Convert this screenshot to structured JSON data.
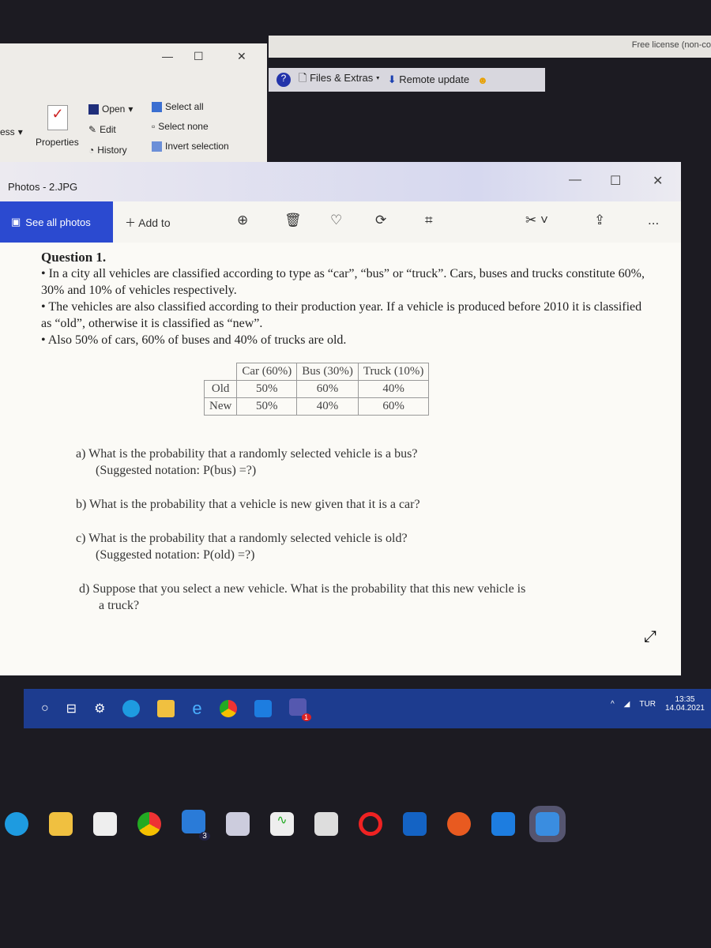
{
  "top": {
    "license_text": "Free license (non-co",
    "files_extras": "Files & Extras",
    "remote_update": "Remote update"
  },
  "explorer": {
    "partial_left": "ess",
    "open": "Open",
    "edit": "Edit",
    "history": "History",
    "properties": "Properties",
    "select_all": "Select all",
    "select_none": "Select none",
    "invert_selection": "Invert selection"
  },
  "photos": {
    "title": "Photos - 2.JPG",
    "see_all": "See all photos",
    "add_to": "Add to",
    "more": "..."
  },
  "doc": {
    "heading": "Question 1.",
    "bullets": [
      "• In a city all vehicles are classified according to type as “car”, “bus” or “truck”. Cars, buses and trucks constitute 60%, 30% and 10% of vehicles respectively.",
      "• The vehicles are also classified according to their production year. If a vehicle is produced before 2010 it is classified as “old”, otherwise it is classified as “new”.",
      "• Also 50% of cars, 60% of buses and 40% of trucks are old."
    ],
    "table": {
      "headers": [
        "",
        "Car (60%)",
        "Bus (30%)",
        "Truck (10%)"
      ],
      "rows": [
        [
          "Old",
          "50%",
          "60%",
          "40%"
        ],
        [
          "New",
          "50%",
          "40%",
          "60%"
        ]
      ]
    },
    "questions": [
      [
        "a) What is the probability that a randomly selected vehicle is a bus?",
        "(Suggested notation: P(bus) =?)"
      ],
      [
        "b) What is the probability that a vehicle is new given that it is a car?",
        ""
      ],
      [
        "c) What is the probability that a randomly selected vehicle is old?",
        "(Suggested notation: P(old) =?)"
      ],
      [
        "d) Suppose that you select a new vehicle. What is the probability that this new vehicle is",
        "a truck?"
      ]
    ]
  },
  "taskbar": {
    "language": "TUR",
    "time": "13:35",
    "date": "14.04.2021",
    "teams_badge": "1",
    "mail_badge": "3"
  }
}
